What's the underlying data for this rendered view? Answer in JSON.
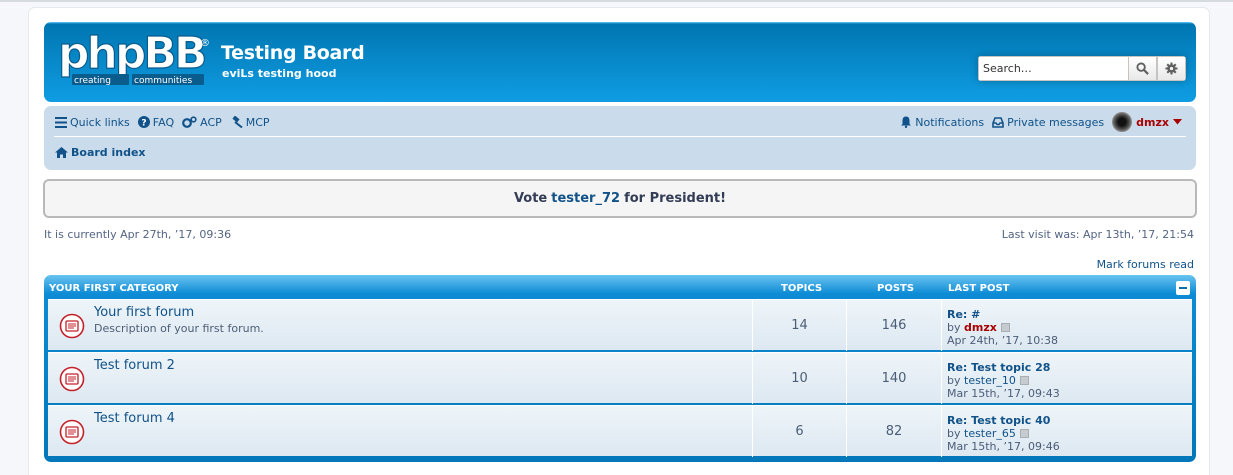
{
  "header": {
    "logo_alt": "phpBB creating communities",
    "site_title": "Testing Board",
    "site_desc": "eviLs testing hood"
  },
  "search": {
    "placeholder": "Search…"
  },
  "nav": {
    "quick_links": "Quick links",
    "faq": "FAQ",
    "acp": "ACP",
    "mcp": "MCP",
    "notifications": "Notifications",
    "private_messages": "Private messages",
    "username": "dmzx",
    "board_index": "Board index"
  },
  "announcement": {
    "prefix": "Vote",
    "name": "tester_72",
    "suffix": "for President!"
  },
  "status": {
    "current_time": "It is currently Apr 27th, ’17, 09:36",
    "last_visit": "Last visit was: Apr 13th, ’17, 21:54",
    "mark_read": "Mark forums read"
  },
  "category": {
    "title": "YOUR FIRST CATEGORY",
    "col_topics": "TOPICS",
    "col_posts": "POSTS",
    "col_lastpost": "LAST POST",
    "forums": [
      {
        "name": "Your first forum",
        "desc": "Description of your first forum.",
        "topics": "14",
        "posts": "146",
        "lp_title": "Re: #",
        "lp_by": "by",
        "lp_user": "dmzx",
        "lp_date": "Apr 24th, ’17, 10:38"
      },
      {
        "name": "Test forum 2",
        "desc": "",
        "topics": "10",
        "posts": "140",
        "lp_title": "Re: Test topic 28",
        "lp_by": "by",
        "lp_user": "tester_10",
        "lp_date": "Mar 15th, ’17, 09:43"
      },
      {
        "name": "Test forum 4",
        "desc": "",
        "topics": "6",
        "posts": "82",
        "lp_title": "Re: Test topic 40",
        "lp_by": "by",
        "lp_user": "tester_65",
        "lp_date": "Mar 15th, ’17, 09:46"
      }
    ]
  },
  "colors": {
    "header_blue": "#0076b1",
    "link": "#105289",
    "admin_user": "#aa0000"
  }
}
